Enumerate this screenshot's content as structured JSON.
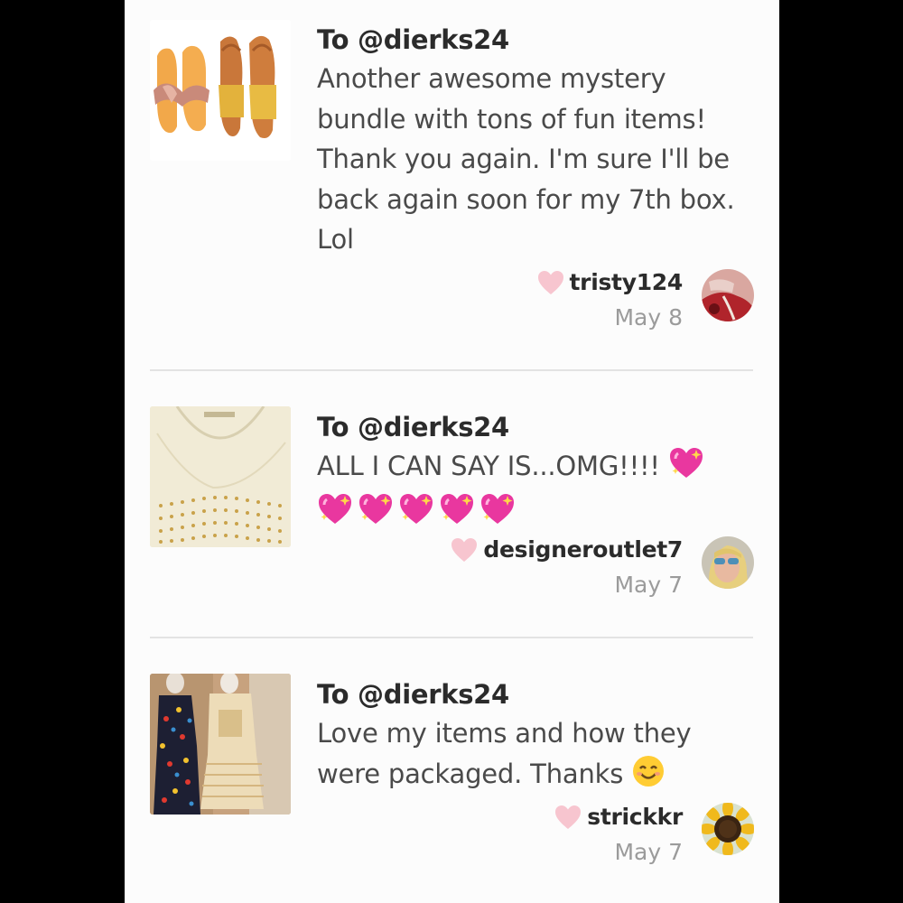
{
  "reviews": [
    {
      "to": "To @dierks24",
      "body": "Another awesome mystery bundle with tons of fun items! Thank you again. I'm sure I'll be back again soon for my 7th box. Lol",
      "username": "tristy124",
      "date": "May 8",
      "thumb_icon": "sandals-photo",
      "avatar_icon": "red-car-avatar"
    },
    {
      "to": "To @dierks24",
      "body": "ALL I CAN SAY IS...OMG!!!!",
      "emoji": [
        "sparkling-heart",
        "sparkling-heart",
        "sparkling-heart",
        "sparkling-heart",
        "sparkling-heart",
        "sparkling-heart"
      ],
      "username": "designeroutlet7",
      "date": "May 7",
      "thumb_icon": "studded-top-photo",
      "avatar_icon": "woman-sunglasses-avatar"
    },
    {
      "to": "To @dierks24",
      "body": "Love my items and how they were packaged. Thanks",
      "emoji": [
        "smiling-face"
      ],
      "username": "strickkr",
      "date": "May 7",
      "thumb_icon": "dresses-photo",
      "avatar_icon": "sunflower-avatar"
    }
  ],
  "colors": {
    "heart": "#f7c5cf",
    "username": "#2b2b2b",
    "date": "#9b9b9b",
    "body": "#4a4a4a"
  }
}
